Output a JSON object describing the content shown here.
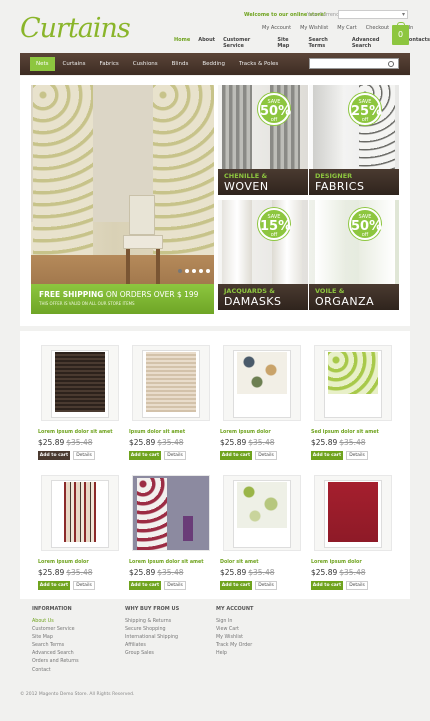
{
  "header": {
    "logo": "Curtains",
    "welcome": "Welcome to our online store!",
    "currency_label": "Your Currency:",
    "currency_value": "",
    "top_links": [
      "My Account",
      "My Wishlist",
      "My Cart",
      "Checkout",
      "Log In"
    ],
    "main_nav": [
      "Home",
      "About",
      "Customer Service",
      "Site Map",
      "Search Terms",
      "Advanced Search",
      "Contacts"
    ],
    "cart_count": "0"
  },
  "categories": [
    "Nets",
    "Curtains",
    "Fabrics",
    "Cushions",
    "Blinds",
    "Bedding",
    "Tracks & Poles"
  ],
  "hero": {
    "banner_l1_strong": "FREE SHIPPING",
    "banner_l1_rest": " ON ORDERS OVER $ 199",
    "banner_l2": "THIS OFFER IS VALID ON ALL OUR STORE ITEMS"
  },
  "promos": [
    {
      "save": "SAVE",
      "pct": "50%",
      "off": "off",
      "label_small": "CHENILLE &",
      "label_big": "WOVEN"
    },
    {
      "save": "SAVE",
      "pct": "25%",
      "off": "off",
      "label_small": "DESIGNER",
      "label_big": "FABRICS"
    },
    {
      "save": "SAVE",
      "pct": "15%",
      "off": "off",
      "label_small": "JACQUARDS &",
      "label_big": "DAMASKS"
    },
    {
      "save": "SAVE",
      "pct": "50%",
      "off": "off",
      "label_small": "VOILE &",
      "label_big": "ORGANZA"
    }
  ],
  "products": [
    {
      "name": "Lorem ipsum dolor sit amet",
      "price": "$25.89",
      "old": "$35.48",
      "cart": "Add to cart",
      "details": "Details"
    },
    {
      "name": "Ipsum dolor sit amet",
      "price": "$25.89",
      "old": "$35.48",
      "cart": "Add to cart",
      "details": "Details"
    },
    {
      "name": "Lorem ipsum dolor",
      "price": "$25.89",
      "old": "$35.48",
      "cart": "Add to cart",
      "details": "Details"
    },
    {
      "name": "Sed ipsum dolor sit amet",
      "price": "$25.89",
      "old": "$35.48",
      "cart": "Add to cart",
      "details": "Details"
    },
    {
      "name": "Lorem ipsum dolor",
      "price": "$25.89",
      "old": "$35.48",
      "cart": "Add to cart",
      "details": "Details"
    },
    {
      "name": "Lorem ipsum dolor sit amet",
      "price": "$25.89",
      "old": "$35.48",
      "cart": "Add to cart",
      "details": "Details"
    },
    {
      "name": "Dolor sit amet",
      "price": "$25.89",
      "old": "$35.48",
      "cart": "Add to cart",
      "details": "Details"
    },
    {
      "name": "Lorem ipsum dolor",
      "price": "$25.89",
      "old": "$35.48",
      "cart": "Add to cart",
      "details": "Details"
    }
  ],
  "footer": {
    "col1_title": "INFORMATION",
    "col1": [
      "About Us",
      "Customer Service",
      "Site Map",
      "Search Terms",
      "Advanced Search",
      "Orders and Returns",
      "Contact"
    ],
    "col2_title": "WHY BUY FROM US",
    "col2": [
      "Shipping & Returns",
      "Secure Shopping",
      "International Shipping",
      "Affiliates",
      "Group Sales"
    ],
    "col3_title": "MY ACCOUNT",
    "col3": [
      "Sign In",
      "View Cart",
      "My Wishlist",
      "Track My Order",
      "Help"
    ],
    "copyright": "© 2012 Magento Demo Store. All Rights Reserved."
  },
  "colors": {
    "accent": "#8dc63f",
    "brown": "#4a3a30"
  }
}
